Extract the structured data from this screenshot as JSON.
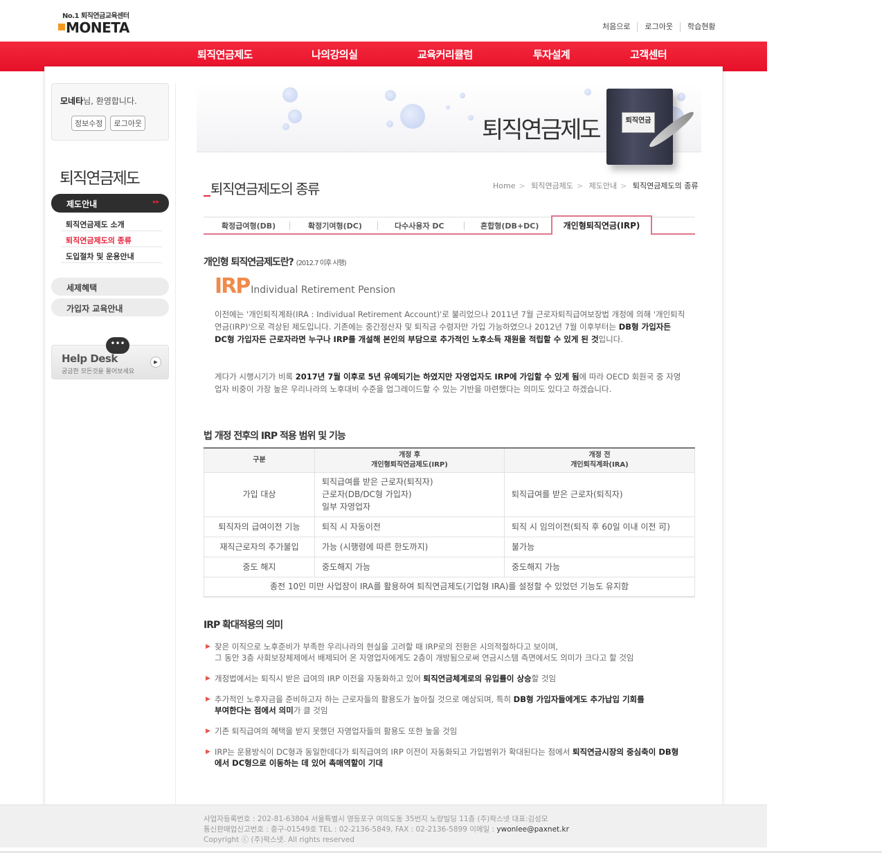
{
  "logo": {
    "tagline": "No.1 퇴직연금교육센터",
    "name": "MONETA"
  },
  "util": [
    "처음으로",
    "로그아웃",
    "학습현황"
  ],
  "gnb": [
    "퇴직연금제도",
    "나의강의실",
    "교육커리큘럼",
    "투자설계",
    "고객센터"
  ],
  "welcome": {
    "name": "모네타",
    "suffix": "님, 환영합니다.",
    "edit": "정보수정",
    "logout": "로그아웃"
  },
  "sidebar": {
    "title": "퇴직연금제도",
    "active": "제도안내",
    "active_icon": "double-chevron-icon",
    "subs": [
      "퇴직연금제도 소개",
      "퇴직연금제도의 종류",
      "도입절차 및 운용안내"
    ],
    "pills": [
      "세제혜택",
      "가입자 교육안내"
    ]
  },
  "helpdesk": {
    "title": "Help Desk",
    "sub": "궁금한 모든것을 물어보세요",
    "bubble": "•••"
  },
  "banner": {
    "title": "퇴직연금제도",
    "book_label": "퇴직연금"
  },
  "page": {
    "title": "퇴직연금제도의 종류"
  },
  "breadcrumb": [
    "Home",
    "퇴직연금제도",
    "제도안내",
    "퇴직연금제도의 종류"
  ],
  "tabs": [
    "확정급여형(DB)",
    "확정기여형(DC)",
    "다수사용자 DC",
    "혼합형(DB+DC)",
    "개인형퇴직연금(IRP)"
  ],
  "section1": {
    "title": "개인형 퇴직연금제도란?",
    "note": "(2012.7 이후 시행)",
    "logo_big": "IRP",
    "logo_sub": "Individual Retirement Pension",
    "p1_a": "이전에는 '개인퇴직계좌(IRA : Individual Retirement Account)'로 불리었으나 2011년 7월 근로자퇴직급여보장법 개정에 의해 '개인퇴직연금(IRP)'으로 격상된 제도입니다. 기존에는 중간정산자 및 퇴직금 수령자만 가입 가능하였으나 2012년 7월 이후부터는 ",
    "p1_b": "DB형 가입자든 DC형 가입자든 근로자라면 누구나 IRP를 개설해 본인의 부담으로 추가적인 노후소득 재원을 적립할 수 있게 된 것",
    "p1_c": "입니다.",
    "p2_a": "게다가 시행시기가 비록 ",
    "p2_b": "2017년 7월 이후로 5년 유예되기는 하였지만 자영업자도 IRP에 가입할 수 있게 됨",
    "p2_c": "에 따라 OECD 회원국 중 자영업자 비중이 가장 높은 우리나라의 노후대비 수준을 업그레이드할 수 있는 기반을 마련했다는 의미도 있다고 하겠습니다."
  },
  "section2": {
    "title": "법 개정 전후의 IRP 적용 범위 및 기능",
    "head": {
      "c0": "구분",
      "c1a": "개정 후",
      "c1b": "개인형퇴직연금제도(IRP)",
      "c2a": "개정 전",
      "c2b": "개인퇴직계좌(IRA)"
    },
    "rows": [
      {
        "label": "가입 대상",
        "after": [
          "퇴직급여를 받은 근로자(퇴직자)",
          "근로자(DB/DC형 가입자)",
          "일부 자영업자"
        ],
        "before": "퇴직급여를 받은 근로자(퇴직자)"
      },
      {
        "label": "퇴직자의 급여이전 기능",
        "after": [
          "퇴직 시 자동이전"
        ],
        "before": "퇴직 시 임의이전(퇴직 후 60일 이내 이전 可)"
      },
      {
        "label": "재직근로자의 추가불입",
        "after": [
          "가능 (시행령에 따른 한도까지)"
        ],
        "before": "불가능"
      },
      {
        "label": "중도 해지",
        "after": [
          "중도해지 가능"
        ],
        "before": "중도해지 가능"
      }
    ],
    "footnote": "종전 10인 미만 사업장이 IRA를 활용하여 퇴직연금제도(기업형 IRA)를 설정할 수 있었던 기능도 유지함"
  },
  "section3": {
    "title": "IRP 확대적용의 의미",
    "items": [
      {
        "a": "잦은 이직으로 노후준비가 부족한 우리나라의 현실을 고려할 때 IRP로의 전환은 시의적절하다고 보이며,",
        "b": "",
        "c": "그 동안 3층 사회보장체제에서 배제되어 온 자영업자에게도 2층이 개방됨으로써 연금시스템 측면에서도 의미가 크다고 할 것임"
      },
      {
        "a": "개정법에서는 퇴직시 받은 급여의 IRP 이전을 자동화하고 있어 ",
        "b": "퇴직연금체계로의 유입률이 상승",
        "c": "할 것임"
      },
      {
        "a": "추가적인 노후자금을 준비하고자 하는 근로자들의 활용도가 높아질 것으로 예상되며, 특히 ",
        "b": "DB형 가입자들에게도 추가납입 기회를 부여한다는 점에서 의미",
        "c": "가 클 것임"
      },
      {
        "a": "기존 퇴직급여의 혜택을 받지 못했던 자영업자들의 활용도 또한 높을 것임",
        "b": "",
        "c": ""
      },
      {
        "a": "IRP는 운용방식이 DC형과 동일한데다가 퇴직급여의 IRP 이전이 자동화되고 가입범위가 확대된다는 점에서 ",
        "b": "퇴직연금시장의 중심축이 DB형에서 DC형으로 이동하는 데 있어 촉매역할이 기대",
        "c": ""
      }
    ]
  },
  "footer": {
    "line1": "사업자등록번호 : 202-81-63804 서울특별시 영등포구 여의도동 35번지 노량빌딩 11층 (주)팍스넷 대표:김성모",
    "line2": "통신판매업신고번호 : 중구-01549호 TEL : 02-2136-5849, FAX : 02-2136-5899 이메일 : ",
    "email": "ywonlee@paxnet.kr",
    "line3": "Copyright ⓒ (주)팍스넷. All rights reserved"
  },
  "colors": {
    "accent": "#e8102a",
    "tab_border": "#e0758a",
    "orange": "#f08a4a"
  }
}
